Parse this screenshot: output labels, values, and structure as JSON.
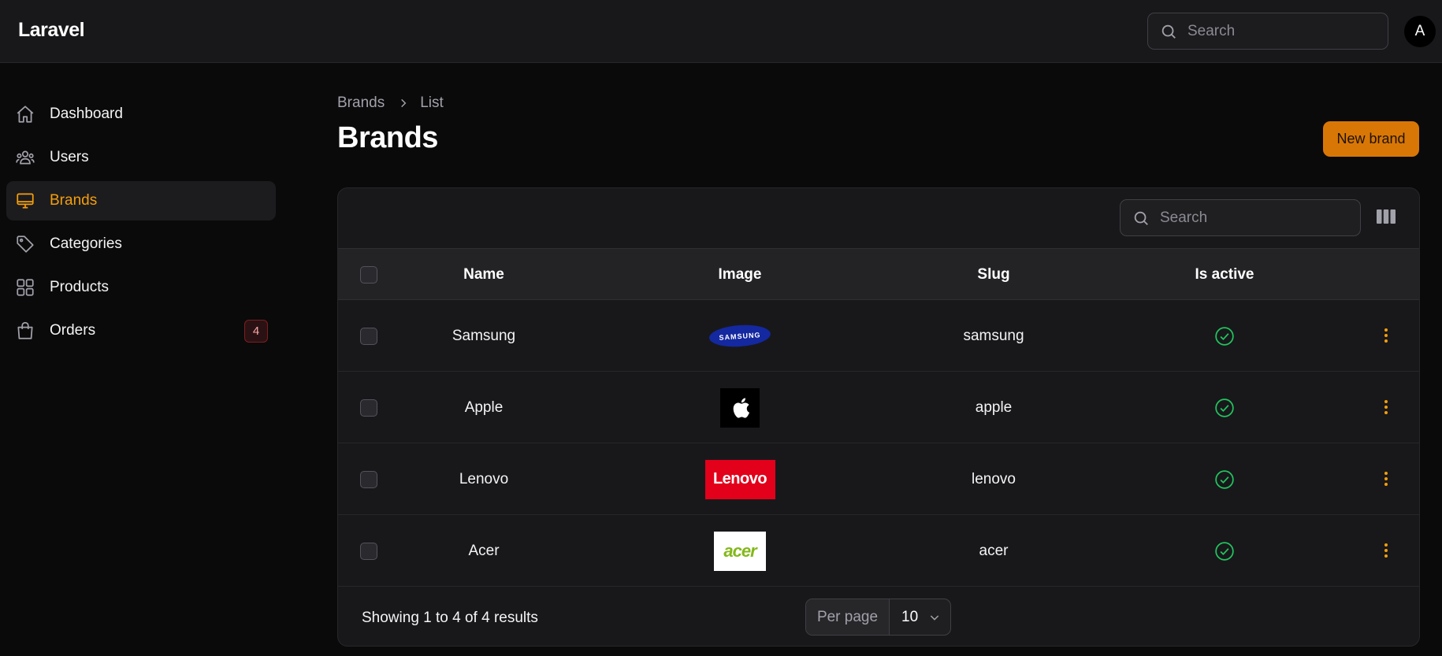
{
  "app": {
    "title": "Laravel"
  },
  "topbar": {
    "search_placeholder": "Search",
    "avatar_initial": "A"
  },
  "sidebar": {
    "items": [
      {
        "label": "Dashboard",
        "icon": "home-icon"
      },
      {
        "label": "Users",
        "icon": "users-icon"
      },
      {
        "label": "Brands",
        "icon": "monitor-icon",
        "active": true
      },
      {
        "label": "Categories",
        "icon": "tag-icon"
      },
      {
        "label": "Products",
        "icon": "grid-icon"
      },
      {
        "label": "Orders",
        "icon": "shopping-bag-icon",
        "badge": "4"
      }
    ]
  },
  "breadcrumb": [
    "Brands",
    "List"
  ],
  "page": {
    "title": "Brands",
    "new_button": "New brand"
  },
  "table": {
    "search_placeholder": "Search",
    "columns": [
      "Name",
      "Image",
      "Slug",
      "Is active"
    ],
    "rows": [
      {
        "name": "Samsung",
        "logo": "SAMSUNG",
        "slug": "samsung",
        "active": true
      },
      {
        "name": "Apple",
        "logo": "apple-logo",
        "slug": "apple",
        "active": true
      },
      {
        "name": "Lenovo",
        "logo": "Lenovo",
        "slug": "lenovo",
        "active": true
      },
      {
        "name": "Acer",
        "logo": "acer",
        "slug": "acer",
        "active": true
      }
    ],
    "footer": {
      "summary": "Showing 1 to 4 of 4 results",
      "per_page_label": "Per page",
      "per_page_value": "10"
    }
  },
  "colors": {
    "accent": "#f59e0b",
    "button": "#d97706",
    "success": "#22c55e",
    "badge_text": "#fca5a5"
  }
}
